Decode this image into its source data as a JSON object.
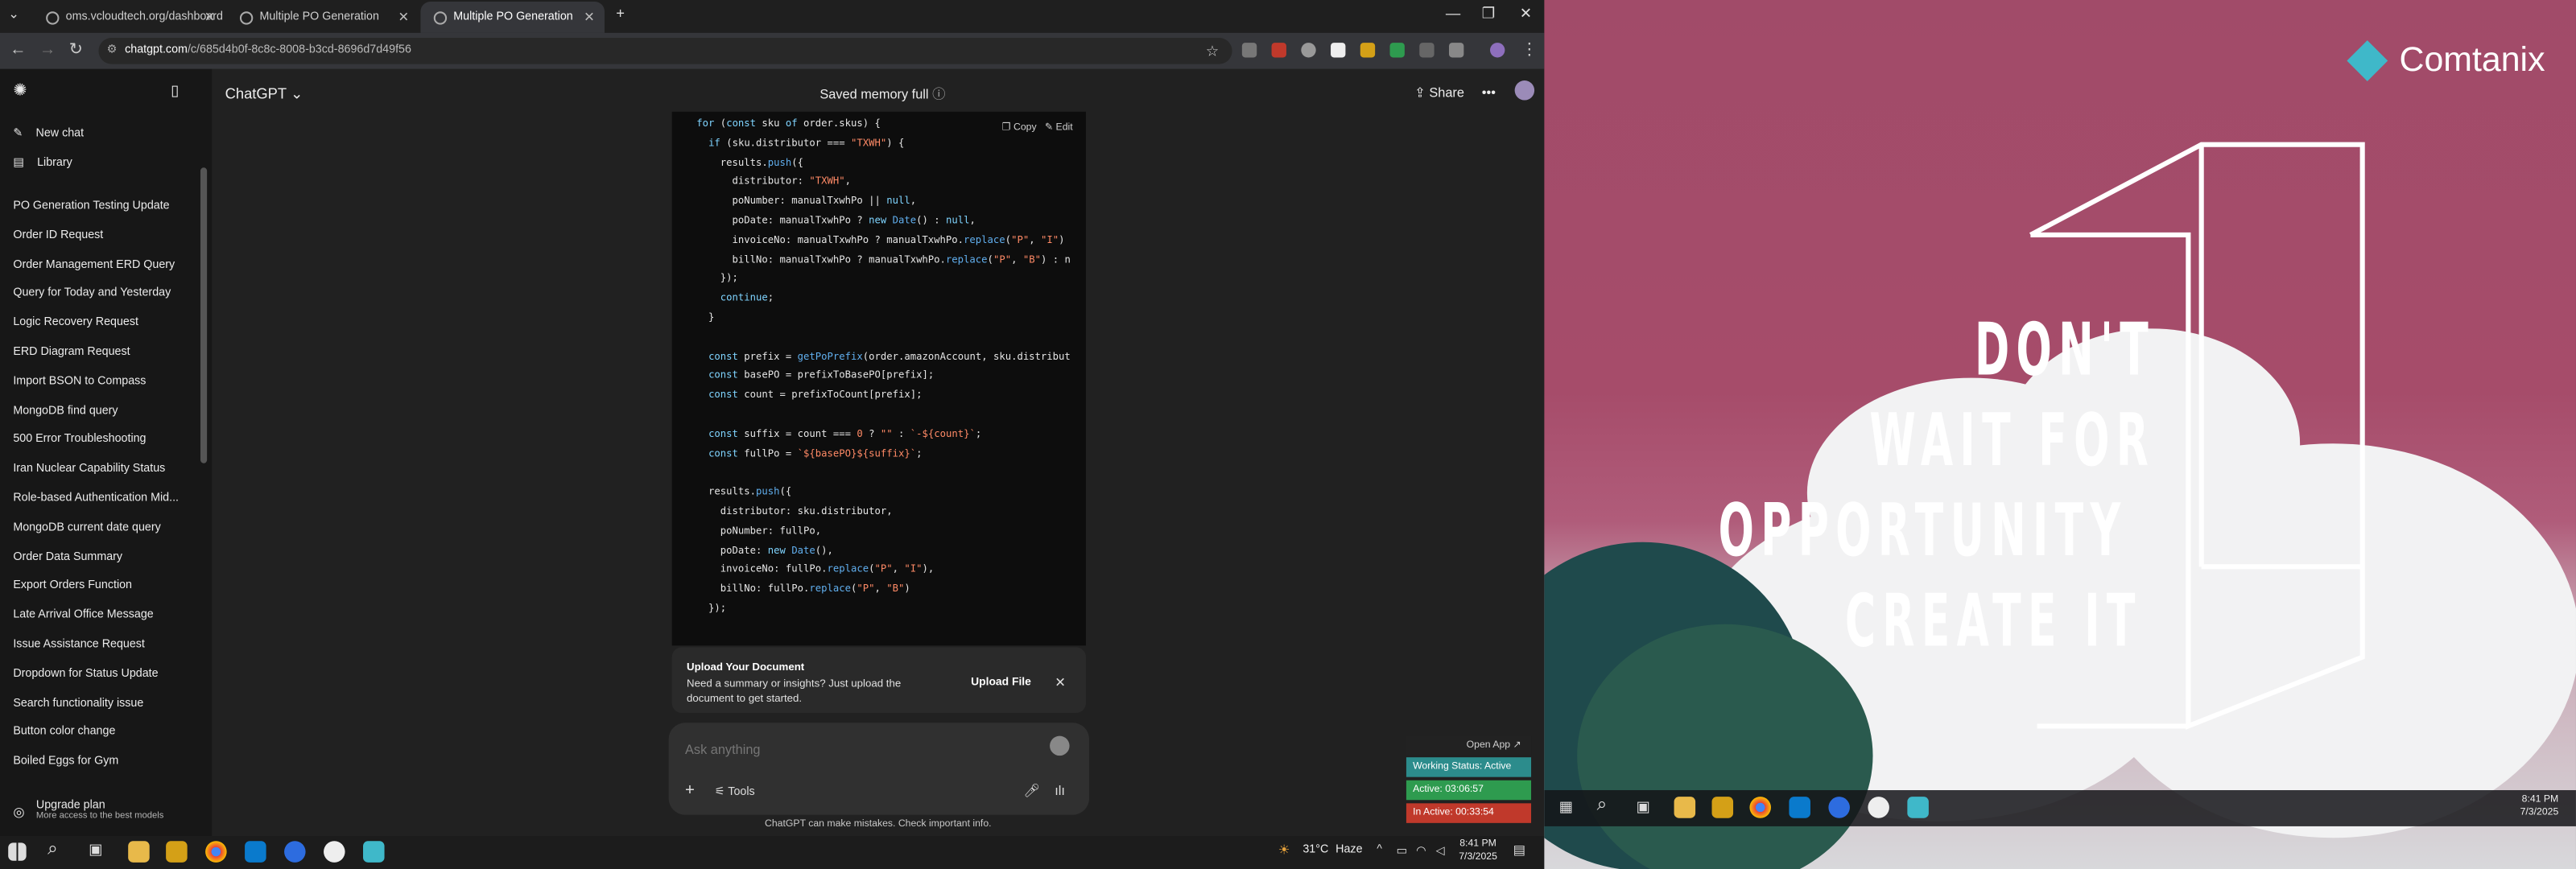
{
  "browser": {
    "tabs": [
      {
        "label": "oms.vcloudtech.org/dashboard",
        "active": false
      },
      {
        "label": "Multiple PO Generation",
        "active": false
      },
      {
        "label": "Multiple PO Generation",
        "active": true
      }
    ],
    "url_host": "chatgpt.com",
    "url_path": "/c/685d4b0f-8c8c-8008-b3cd-8696d7d49f56"
  },
  "sidebar": {
    "new_chat": "New chat",
    "library": "Library",
    "chats": [
      "PO Generation Testing Update",
      "Order ID Request",
      "Order Management ERD Query",
      "Query for Today and Yesterday",
      "Logic Recovery Request",
      "ERD Diagram Request",
      "Import BSON to Compass",
      "MongoDB find query",
      "500 Error Troubleshooting",
      "Iran Nuclear Capability Status",
      "Role-based Authentication Mid...",
      "MongoDB current date query",
      "Order Data Summary",
      "Export Orders Function",
      "Late Arrival Office Message",
      "Issue Assistance Request",
      "Dropdown for Status Update",
      "Search functionality issue",
      "Button color change",
      "Boiled Eggs for Gym"
    ],
    "upgrade_title": "Upgrade plan",
    "upgrade_sub": "More access to the best models"
  },
  "header": {
    "model": "ChatGPT",
    "memory": "Saved memory full",
    "share": "Share"
  },
  "code": {
    "copy": "Copy",
    "edit": "Edit"
  },
  "upload_card": {
    "title": "Upload Your Document",
    "text": "Need a summary or insights? Just upload the document to get started.",
    "button": "Upload File"
  },
  "composer": {
    "placeholder": "Ask anything",
    "tools": "Tools"
  },
  "disclaimer": "ChatGPT can make mistakes. Check important info.",
  "taskbar": {
    "weather": "31°C",
    "weather_desc": "Haze",
    "time": "8:41 PM",
    "date": "7/3/2025"
  },
  "widget": {
    "open_app": "Open App",
    "status": "Working Status: Active",
    "active": "Active: 03:06:57",
    "inactive": "In Active: 00:33:54"
  },
  "wallpaper": {
    "brand": "Comtanix",
    "lines": [
      "DON'T",
      "WAIT FOR",
      "OPPORTUNITY",
      "CREATE IT"
    ]
  },
  "right_taskbar": {
    "time": "8:41 PM",
    "date": "7/3/2025"
  },
  "colors": {
    "accent_green": "#2e9b4f",
    "accent_red": "#c0392b",
    "status_teal": "#2c8c8c",
    "wallpaper_pink": "#a14b69"
  }
}
